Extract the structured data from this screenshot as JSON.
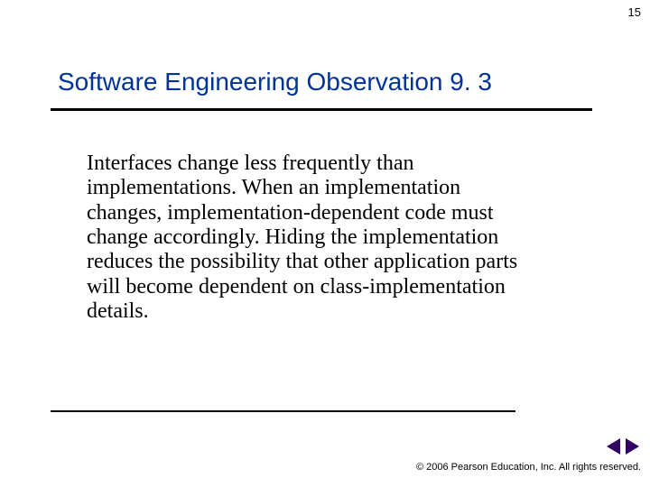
{
  "page_number": "15",
  "title": "Software Engineering Observation 9. 3",
  "body": "Interfaces change less frequently than implementations. When an implementation changes, implementation-dependent code must change accordingly. Hiding the implementation reduces the possibility that other application parts will become dependent on class-implementation details.",
  "copyright": "© 2006 Pearson Education, Inc.  All rights reserved."
}
